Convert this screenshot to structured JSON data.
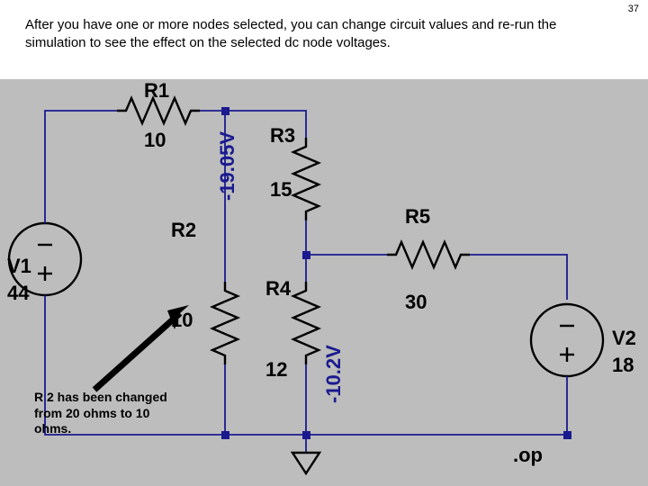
{
  "page_number": "37",
  "instruction_text": "After you have one or more nodes selected, you can change circuit values and re-run the simulation to see the effect on the selected dc node voltages.",
  "components": {
    "R1": {
      "label": "R1",
      "value": "10"
    },
    "R2": {
      "label": "R2",
      "value": "10"
    },
    "R3": {
      "label": "R3",
      "value": "15"
    },
    "R4": {
      "label": "R4",
      "value": "12"
    },
    "R5": {
      "label": "R5",
      "value": "30"
    },
    "V1": {
      "label": "V1",
      "value": "44"
    },
    "V2": {
      "label": "V2",
      "value": "18"
    }
  },
  "node_voltages": {
    "n1": "-19.05V",
    "n2": "-10.2V"
  },
  "annotation": "R 2 has been changed from 20 ohms to 10 ohms.",
  "directive": ".op"
}
